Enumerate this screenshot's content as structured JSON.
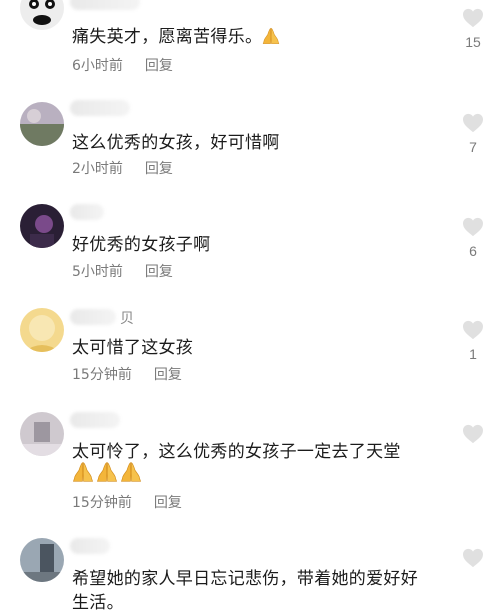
{
  "comments": [
    {
      "name_suffix": "",
      "text": "痛失英才，愿离苦得乐。",
      "emoji_count": 1,
      "time": "6小时前",
      "reply": "回复",
      "likes": "15"
    },
    {
      "name_suffix": "",
      "text": "这么优秀的女孩，好可惜啊",
      "emoji_count": 0,
      "time": "2小时前",
      "reply": "回复",
      "likes": "7"
    },
    {
      "name_suffix": "",
      "text": "好优秀的女孩子啊",
      "emoji_count": 0,
      "time": "5小时前",
      "reply": "回复",
      "likes": "6"
    },
    {
      "name_suffix": "贝",
      "text": "太可惜了这女孩",
      "emoji_count": 0,
      "time": "15分钟前",
      "reply": "回复",
      "likes": "1"
    },
    {
      "name_suffix": "",
      "text": "太可怜了，这么优秀的女孩子一定去了天堂",
      "emoji_count": 3,
      "time": "15分钟前",
      "reply": "回复",
      "likes": ""
    },
    {
      "name_suffix": "",
      "text": "希望她的家人早日忘记悲伤，带着她的爱好好",
      "text_line2": "生活。",
      "emoji_count": 0,
      "time": "",
      "reply": "",
      "likes": ""
    }
  ],
  "icons": {
    "like": "heart-icon",
    "emoji": "folded-hands-emoji"
  },
  "colors": {
    "meta": "#7a7a7a",
    "heart": "#e2e2e2",
    "emoji": "#f3b63c"
  }
}
